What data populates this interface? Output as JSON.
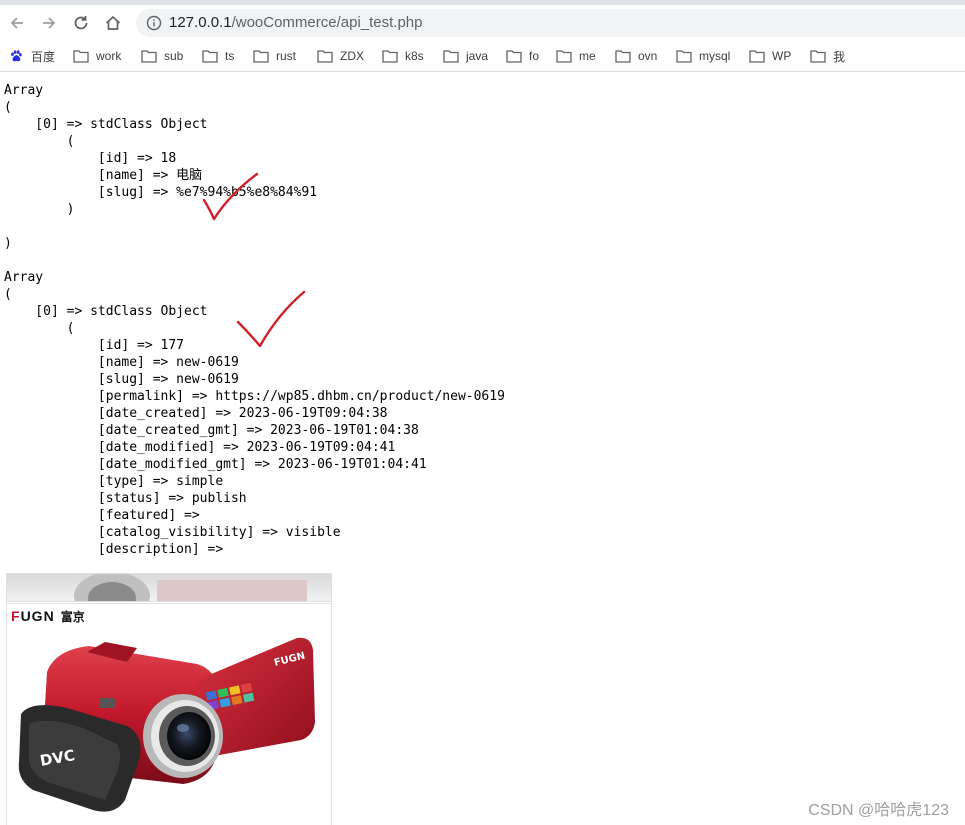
{
  "browser": {
    "url_host": "127.0.0.1",
    "url_path": "/wooCommerce/api_test.php",
    "bookmarks": [
      "百度",
      "work",
      "sub",
      "ts",
      "rust",
      "ZDX",
      "k8s",
      "java",
      "fo",
      "me",
      "ovn",
      "mysql",
      "WP",
      "我"
    ]
  },
  "output": {
    "lines": [
      "Array",
      "(",
      "    [0] => stdClass Object",
      "        (",
      "            [id] => 18",
      "            [name] => 电脑",
      "            [slug] => %e7%94%b5%e8%84%91",
      "        )",
      "",
      ")",
      "",
      "Array",
      "(",
      "    [0] => stdClass Object",
      "        (",
      "            [id] => 177",
      "            [name] => new-0619",
      "            [slug] => new-0619",
      "            [permalink] => https://wp85.dhbm.cn/product/new-0619",
      "            [date_created] => 2023-06-19T09:04:38",
      "            [date_created_gmt] => 2023-06-19T01:04:38",
      "            [date_modified] => 2023-06-19T09:04:41",
      "            [date_modified_gmt] => 2023-06-19T01:04:41",
      "            [type] => simple",
      "            [status] => publish",
      "            [featured] =>",
      "            [catalog_visibility] => visible",
      "            [description] =>"
    ]
  },
  "product_image": {
    "brand_latin_first": "F",
    "brand_latin_rest": "UGN",
    "brand_cn": "富京",
    "body_logo": "FUGN",
    "strap_text": "DVC"
  },
  "watermark": "CSDN @哈哈虎123",
  "colors": {
    "check_mark": "#d0202a",
    "camera_red": "#c0182a"
  }
}
